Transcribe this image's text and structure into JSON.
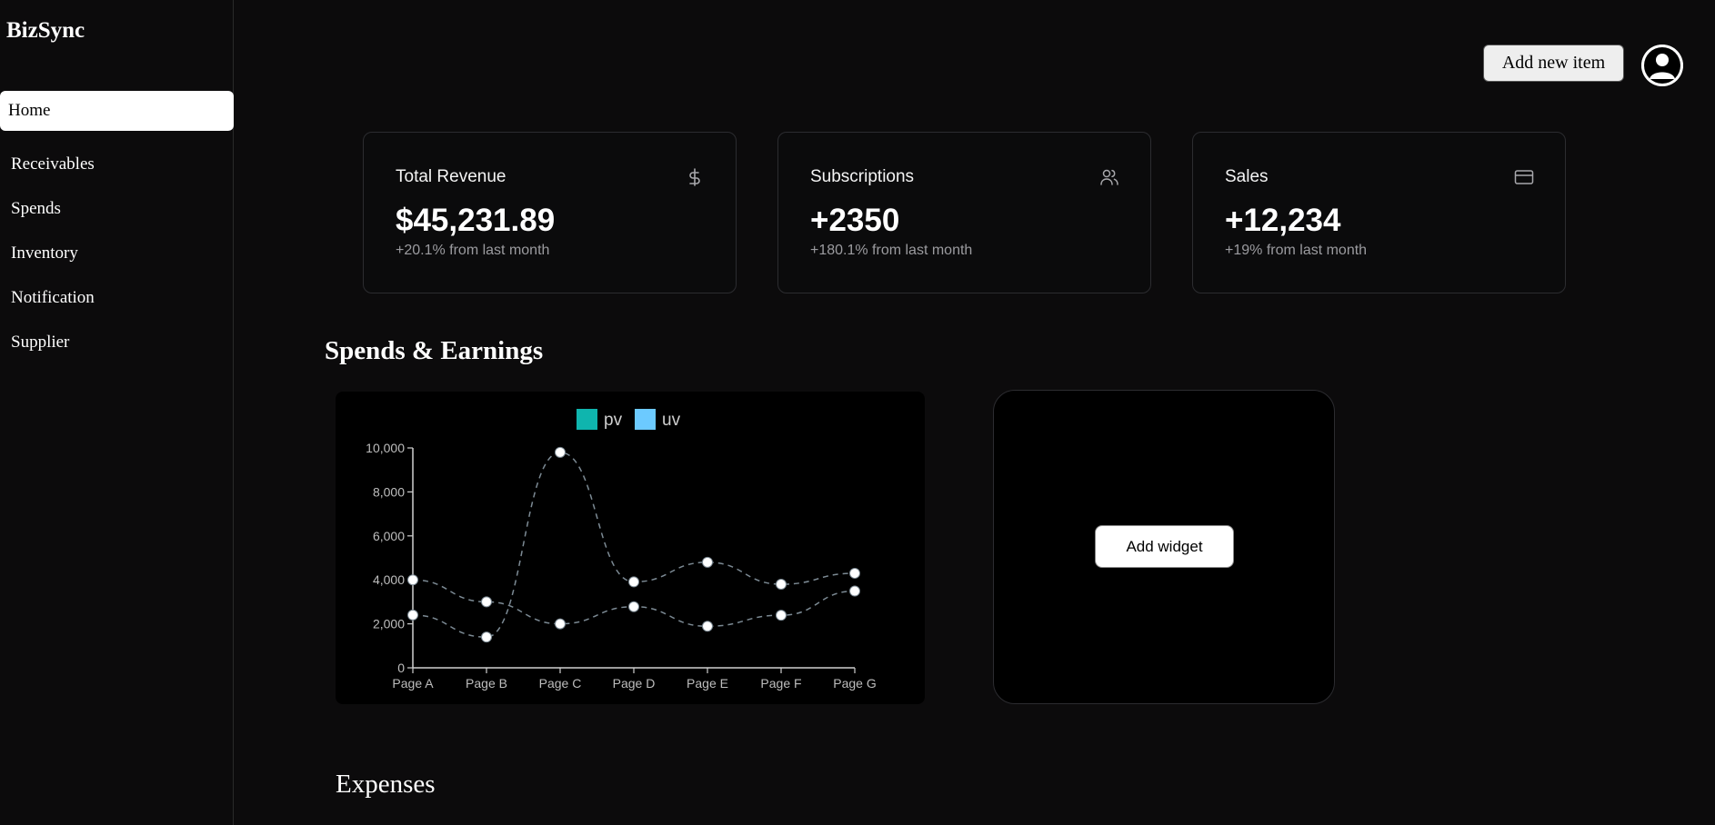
{
  "app": {
    "brand": "BizSync"
  },
  "sidebar": {
    "items": [
      {
        "label": "Home",
        "active": true
      },
      {
        "label": "Receivables"
      },
      {
        "label": "Spends"
      },
      {
        "label": "Inventory"
      },
      {
        "label": "Notification"
      },
      {
        "label": "Supplier"
      }
    ]
  },
  "header": {
    "add_button": "Add new item",
    "avatar_icon": "user-avatar-icon"
  },
  "stats": [
    {
      "title": "Total Revenue",
      "value": "$45,231.89",
      "sub": "+20.1% from last month",
      "icon": "dollar-icon"
    },
    {
      "title": "Subscriptions",
      "value": "+2350",
      "sub": "+180.1% from last month",
      "icon": "users-icon"
    },
    {
      "title": "Sales",
      "value": "+12,234",
      "sub": "+19% from last month",
      "icon": "credit-card-icon"
    }
  ],
  "section": {
    "title": "Spends & Earnings"
  },
  "chart_data": {
    "type": "line",
    "categories": [
      "Page A",
      "Page B",
      "Page C",
      "Page D",
      "Page E",
      "Page F",
      "Page G"
    ],
    "series": [
      {
        "name": "pv",
        "color": "#0fb5ae",
        "values": [
          2400,
          1398,
          9800,
          3908,
          4800,
          3800,
          4300
        ]
      },
      {
        "name": "uv",
        "color": "#6ccaff",
        "values": [
          4000,
          3000,
          2000,
          2780,
          1890,
          2390,
          3490
        ]
      }
    ],
    "ylim": [
      0,
      10000
    ],
    "yticks": [
      "0",
      "2,000",
      "4,000",
      "6,000",
      "8,000",
      "10,000"
    ],
    "legend": "top-center",
    "grid": false
  },
  "widget": {
    "button": "Add widget"
  },
  "expenses": {
    "title": "Expenses"
  }
}
